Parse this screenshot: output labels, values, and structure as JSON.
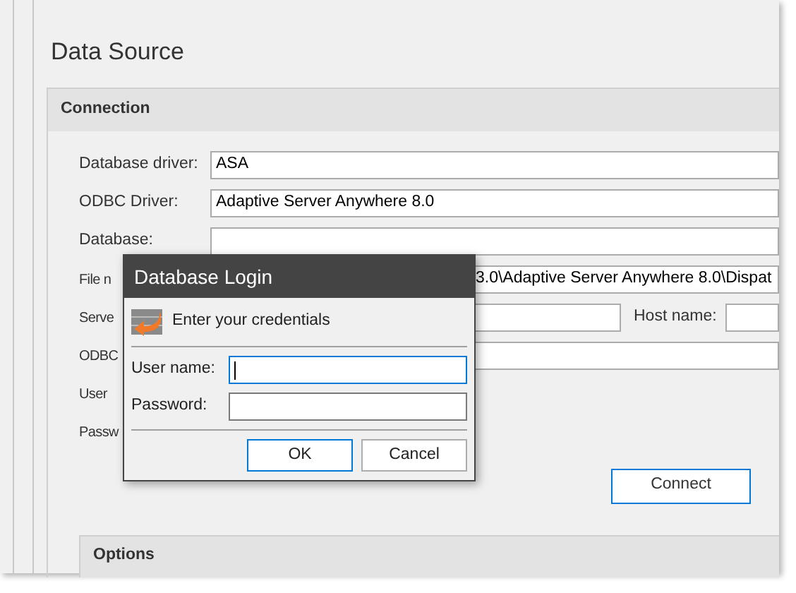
{
  "page": {
    "title": "Data Source"
  },
  "connection": {
    "title": "Connection",
    "rows": [
      {
        "kind": "field",
        "label": "Database driver:",
        "value": "ASA"
      },
      {
        "kind": "field",
        "label": "ODBC Driver:",
        "value": "Adaptive Server Anywhere 8.0"
      },
      {
        "kind": "field",
        "label": "Database:"
      },
      {
        "kind": "covered-field",
        "label": "File n",
        "value": "3.0\\Adaptive Server Anywhere 8.0\\Dispat"
      },
      {
        "kind": "covered-pair",
        "label": "Serve",
        "label_2": "Host name:"
      },
      {
        "kind": "covered-field",
        "label": "ODBC"
      },
      {
        "kind": "label",
        "label": "User"
      },
      {
        "kind": "label",
        "label": "Passw"
      }
    ],
    "connect_button": "Connect"
  },
  "options": {
    "title": "Options"
  },
  "dialog": {
    "title": "Database Login",
    "message": "Enter your credentials",
    "fields": [
      {
        "label": "User name:",
        "focused": true
      },
      {
        "label": "Password:",
        "focused": false
      }
    ],
    "buttons": [
      {
        "label": "OK",
        "default": true
      },
      {
        "label": "Cancel",
        "default": false
      }
    ]
  }
}
